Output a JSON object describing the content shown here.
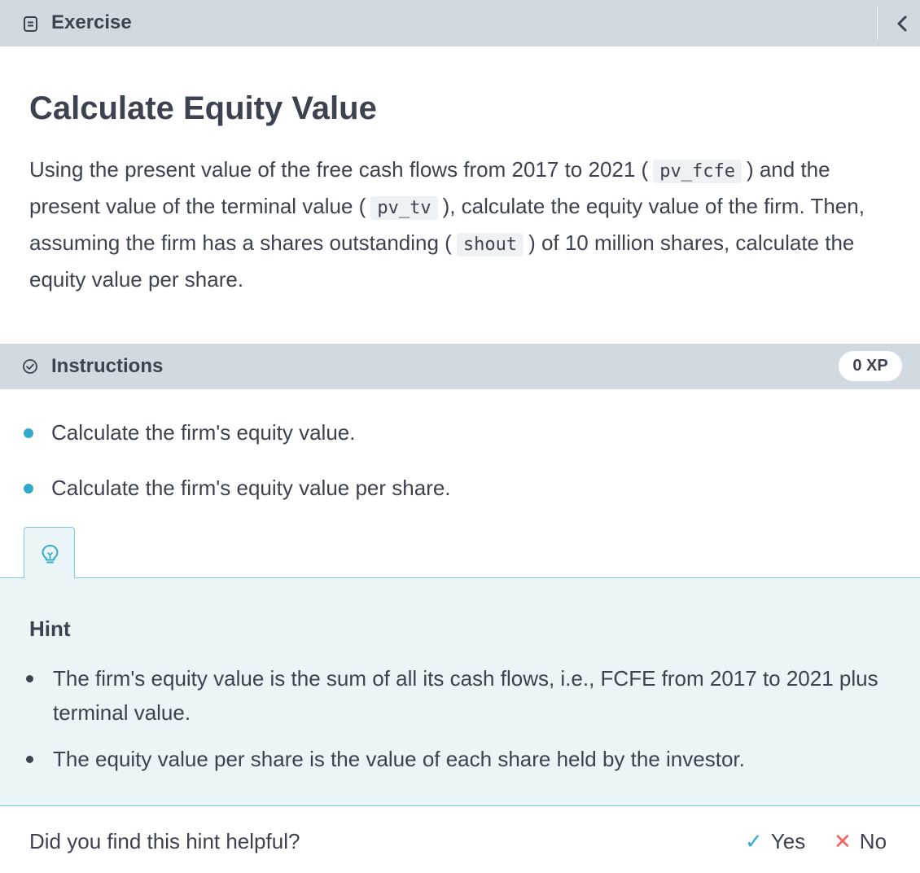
{
  "header": {
    "title": "Exercise",
    "icon": "document-icon",
    "collapse_icon": "chevron-left-icon"
  },
  "exercise": {
    "title": "Calculate Equity Value",
    "description": {
      "p1": "Using the present value of the free cash flows from 2017 to 2021 (",
      "code1": "pv_fcfe",
      "p2": ") and the present value of the terminal value (",
      "code2": "pv_tv",
      "p3": "), calculate the equity value of the firm. Then, assuming the firm has a shares outstanding (",
      "code3": "shout",
      "p4": ") of 10 million shares, calculate the equity value per share."
    }
  },
  "instructions": {
    "label": "Instructions",
    "icon": "check-circle-icon",
    "xp": "0 XP",
    "items": [
      "Calculate the firm's equity value.",
      "Calculate the firm's equity value per share."
    ]
  },
  "hint": {
    "icon": "lightbulb-icon",
    "title": "Hint",
    "items": [
      "The firm's equity value is the sum of all its cash flows, i.e., FCFE from 2017 to 2021 plus terminal value.",
      "The equity value per share is the value of each share held by the investor."
    ]
  },
  "feedback": {
    "question": "Did you find this hint helpful?",
    "yes_label": "Yes",
    "no_label": "No",
    "yes_symbol": "✓",
    "no_symbol": "✕",
    "yes_color": "#33aacc",
    "no_color": "#fe5c5c"
  }
}
